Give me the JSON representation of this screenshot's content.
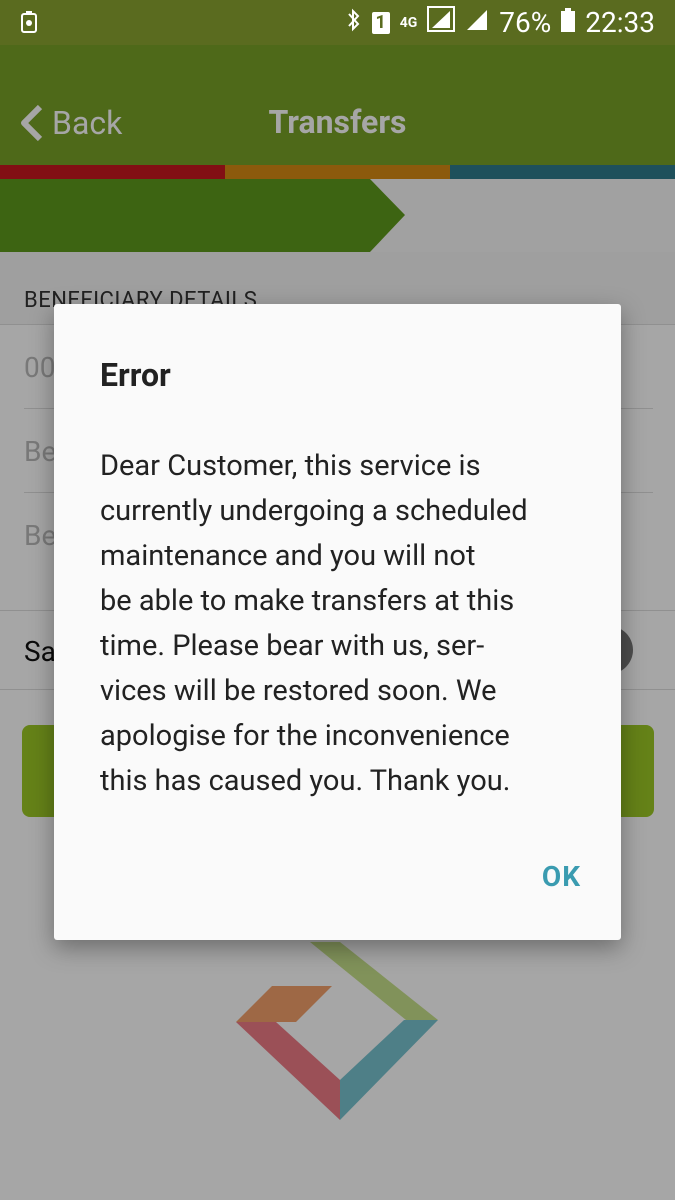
{
  "status_bar": {
    "battery_saver_icon": "battery-saver-icon",
    "bluetooth_icon": "bluetooth-icon",
    "sim_label": "1",
    "network_label": "4G",
    "battery_percent": "76%",
    "time": "22:33"
  },
  "app_bar": {
    "back_label": "Back",
    "title": "Transfers"
  },
  "colors": {
    "status_bar": "#5a6b1f",
    "app_bar": "#78a127",
    "stripe_red": "#c8171f",
    "stripe_orange": "#d88a13",
    "stripe_teal": "#2f7b8d",
    "ok_button": "#3a9bb0"
  },
  "form": {
    "section_header": "BENEFICIARY DETAILS",
    "field1_value": "00",
    "field2_placeholder": "Be",
    "field3_placeholder": "Be",
    "save_label": "Sa"
  },
  "dialog": {
    "title": "Error",
    "message": "Dear Customer, this service is\ncurrently undergoing a scheduled\nmaintenance and you will not\nbe able to make transfers at this\ntime. Please bear with us, ser-\nvices will be restored soon. We\napologise for the inconvenience\nthis has caused you. Thank you.",
    "ok_label": "OK"
  }
}
